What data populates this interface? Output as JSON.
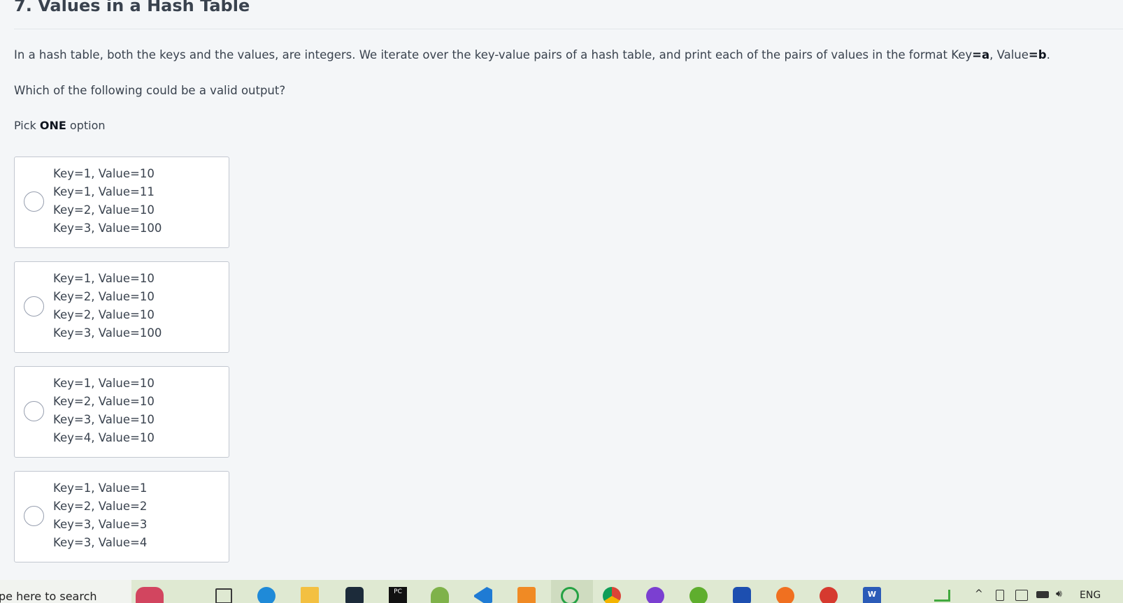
{
  "question": {
    "title": "7. Values in a Hash Table",
    "description_parts": [
      "In a hash table, both the keys and the values, are integers. We iterate over the key-value pairs of a hash table, and print each of the pairs of values in the format Key",
      "=a",
      ", Value",
      "=b",
      "."
    ],
    "prompt": "Which of the following could be a valid output?",
    "pick_prefix": "Pick ",
    "pick_bold": "ONE",
    "pick_suffix": " option"
  },
  "options": [
    {
      "lines": [
        "Key=1, Value=10",
        "Key=1, Value=11",
        "Key=2, Value=10",
        "Key=3, Value=100"
      ]
    },
    {
      "lines": [
        "Key=1, Value=10",
        "Key=2, Value=10",
        "Key=2, Value=10",
        "Key=3, Value=100"
      ]
    },
    {
      "lines": [
        "Key=1, Value=10",
        "Key=2, Value=10",
        "Key=3, Value=10",
        "Key=4, Value=10"
      ]
    },
    {
      "lines": [
        "Key=1, Value=1",
        "Key=2, Value=2",
        "Key=3, Value=3",
        "Key=3, Value=4"
      ]
    }
  ],
  "taskbar": {
    "search_placeholder": "pe here to search",
    "pc_label": "PC",
    "word_label": "W",
    "language": "ENG",
    "icons": [
      {
        "name": "app-sticker-icon",
        "color": "#d2455f"
      },
      {
        "name": "task-view-icon",
        "color": "#3a3a3a"
      },
      {
        "name": "edge-browser-icon",
        "color": "#1f8ad8"
      },
      {
        "name": "file-explorer-icon",
        "color": "#f3c041"
      },
      {
        "name": "terminal-app-icon",
        "color": "#1c2b3a"
      },
      {
        "name": "pycharm-icon",
        "color": "#111111"
      },
      {
        "name": "frog-app-icon",
        "color": "#7fb24a"
      },
      {
        "name": "vscode-icon",
        "color": "#1f7bd4"
      },
      {
        "name": "sublime-text-icon",
        "color": "#f08a24"
      },
      {
        "name": "whatsapp-icon",
        "color": "#25a244"
      },
      {
        "name": "chrome-icon",
        "color": "#db4437"
      },
      {
        "name": "vpn-app-icon",
        "color": "#7b3fd1"
      },
      {
        "name": "utorrent-icon",
        "color": "#5fae2e"
      },
      {
        "name": "webex-icon",
        "color": "#1d4fb0"
      },
      {
        "name": "avast-icon",
        "color": "#f07020"
      },
      {
        "name": "ccleaner-icon",
        "color": "#d63a2f"
      },
      {
        "name": "word-icon",
        "color": "#2b5bb8"
      },
      {
        "name": "chart-app-icon",
        "color": "#41a83e"
      }
    ]
  }
}
